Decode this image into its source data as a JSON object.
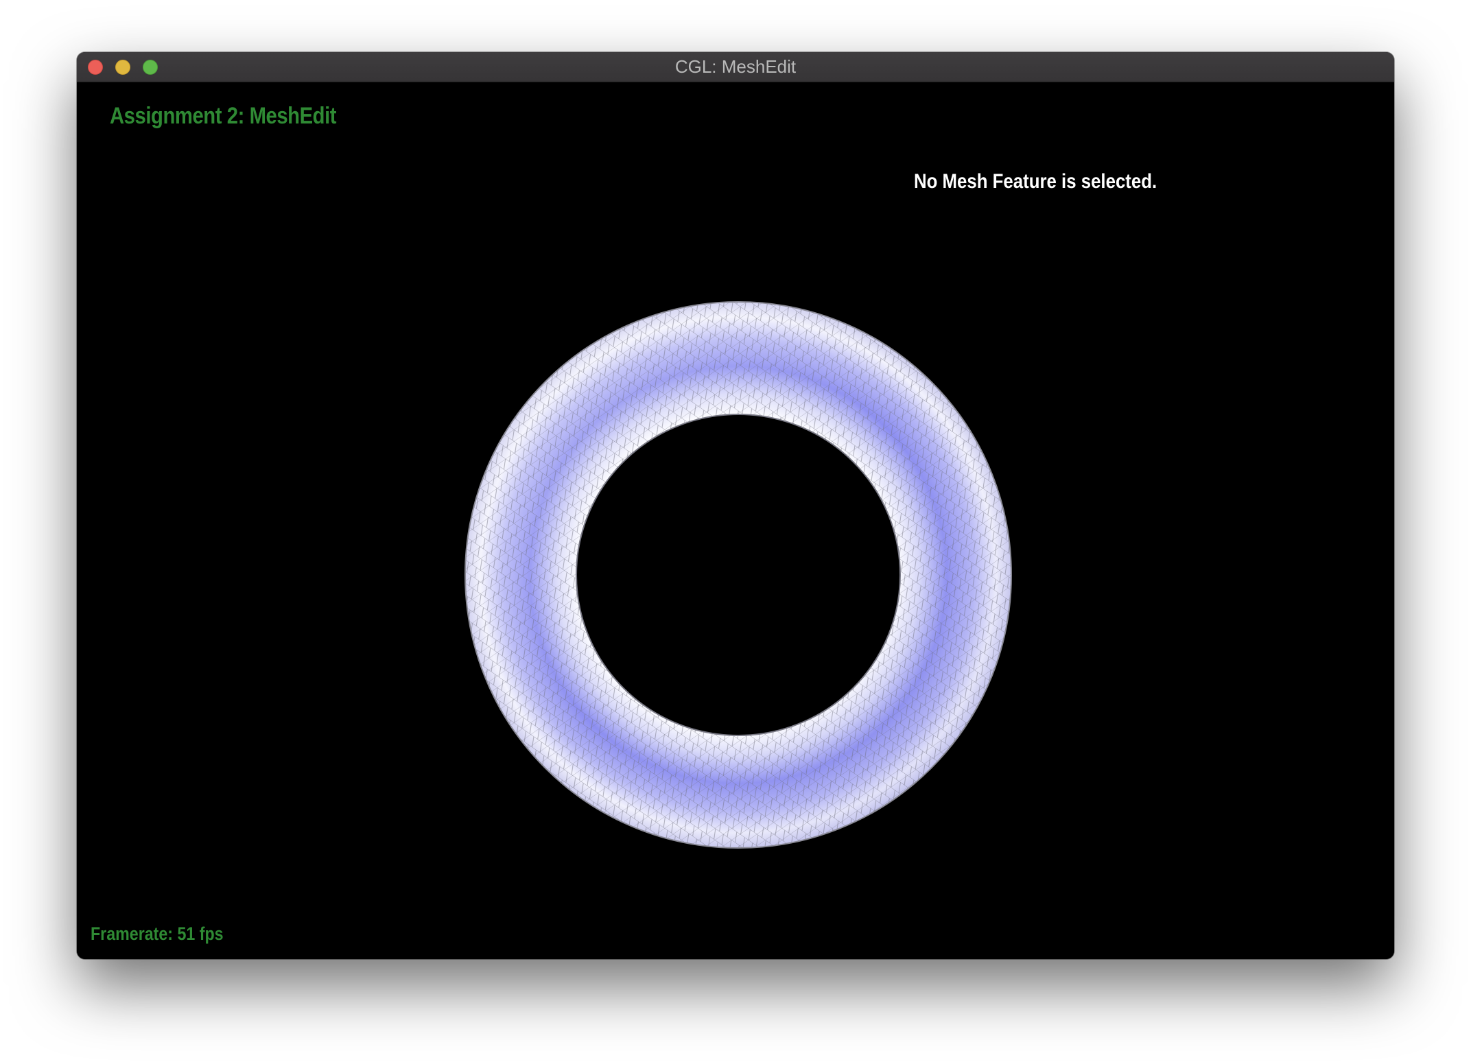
{
  "window": {
    "title": "CGL: MeshEdit",
    "buttons": [
      "close",
      "minimize",
      "maximize"
    ]
  },
  "hud": {
    "app_title": "Assignment 2: MeshEdit",
    "selection_status": "No Mesh Feature is selected.",
    "framerate_label": "Framerate: 51 fps"
  },
  "scene": {
    "object": "torus",
    "icon": "torus-mesh",
    "colors": {
      "background": "#000000",
      "mesh_fill": "#8a8cf0",
      "mesh_highlight": "#ffffff",
      "wireframe": "#6f6f6f",
      "hud_green": "#2f8a34"
    }
  }
}
